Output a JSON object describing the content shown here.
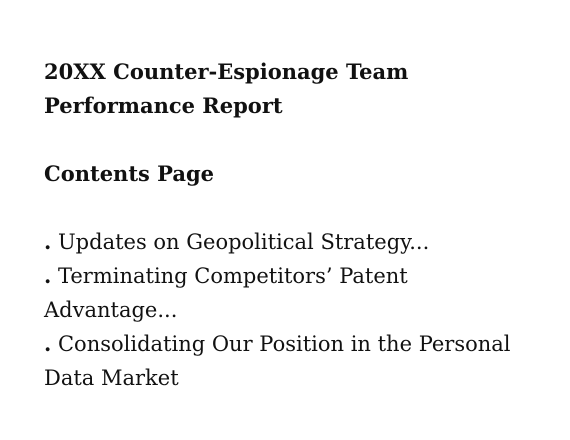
{
  "document": {
    "title_line1": "20XX Counter-Espionage Team",
    "title_line2": "Performance Report",
    "contents_heading": "Contents Page",
    "toc_items": [
      {
        "bullet": ".",
        "text": " Updates on Geopolitical Strategy..."
      },
      {
        "bullet": ".",
        "text": " Terminating Competitors’ Patent Advantage..."
      },
      {
        "bullet": ".",
        "text": " Consolidating Our Position in the Personal Data Market"
      }
    ]
  }
}
